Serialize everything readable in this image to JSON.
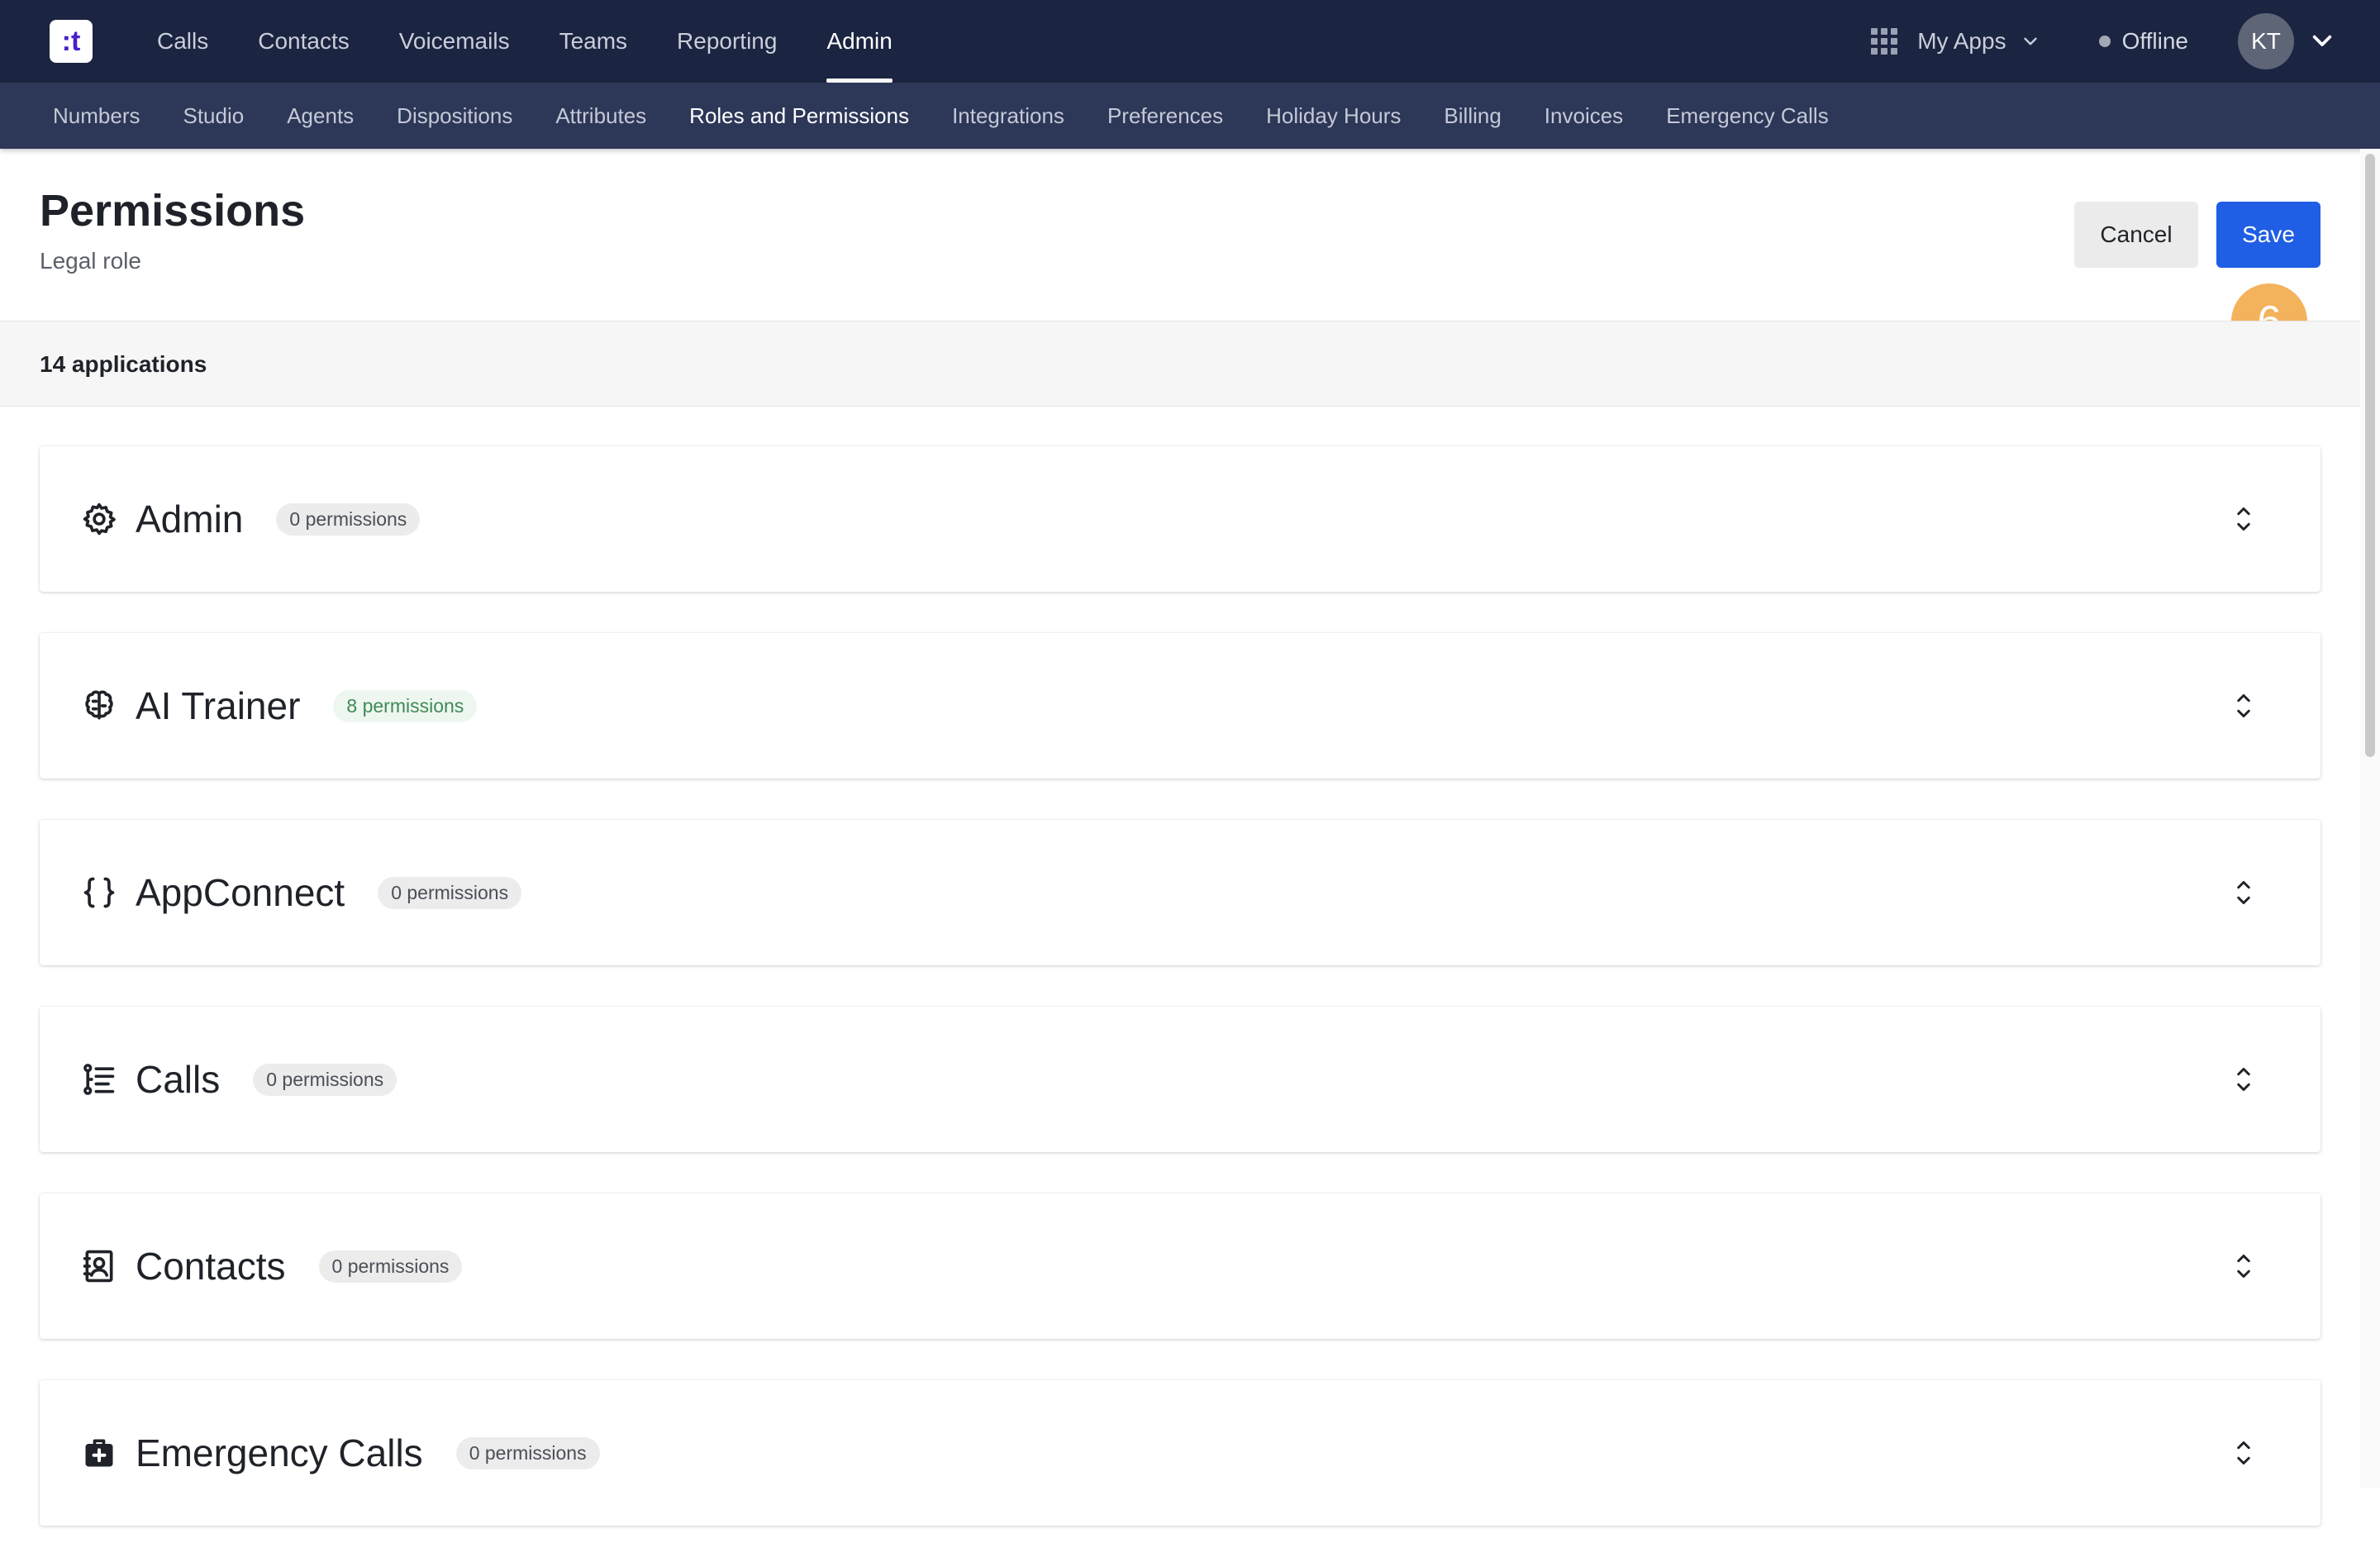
{
  "logo": {
    "text": ":t"
  },
  "topnav": [
    {
      "label": "Calls",
      "name": "topnav-calls"
    },
    {
      "label": "Contacts",
      "name": "topnav-contacts"
    },
    {
      "label": "Voicemails",
      "name": "topnav-voicemails"
    },
    {
      "label": "Teams",
      "name": "topnav-teams"
    },
    {
      "label": "Reporting",
      "name": "topnav-reporting"
    },
    {
      "label": "Admin",
      "name": "topnav-admin",
      "active": true
    }
  ],
  "topright": {
    "apps_label": "My Apps",
    "status_label": "Offline",
    "avatar_initials": "KT"
  },
  "subnav": [
    {
      "label": "Numbers"
    },
    {
      "label": "Studio"
    },
    {
      "label": "Agents"
    },
    {
      "label": "Dispositions"
    },
    {
      "label": "Attributes"
    },
    {
      "label": "Roles and Permissions",
      "active": true
    },
    {
      "label": "Integrations"
    },
    {
      "label": "Preferences"
    },
    {
      "label": "Holiday Hours"
    },
    {
      "label": "Billing"
    },
    {
      "label": "Invoices"
    },
    {
      "label": "Emergency Calls"
    }
  ],
  "header": {
    "title": "Permissions",
    "subtitle": "Legal role",
    "cancel_label": "Cancel",
    "save_label": "Save",
    "step_badge": "6"
  },
  "applications": {
    "count_label": "14 applications",
    "items": [
      {
        "title": "Admin",
        "permissions": "0 permissions",
        "icon": "gear-icon",
        "highlight": false
      },
      {
        "title": "AI Trainer",
        "permissions": "8 permissions",
        "icon": "brain-icon",
        "highlight": true
      },
      {
        "title": "AppConnect",
        "permissions": "0 permissions",
        "icon": "braces-icon",
        "highlight": false
      },
      {
        "title": "Calls",
        "permissions": "0 permissions",
        "icon": "call-list-icon",
        "highlight": false
      },
      {
        "title": "Contacts",
        "permissions": "0 permissions",
        "icon": "contact-book-icon",
        "highlight": false
      },
      {
        "title": "Emergency Calls",
        "permissions": "0 permissions",
        "icon": "medical-kit-icon",
        "highlight": false
      }
    ]
  },
  "colors": {
    "topbar": "#1b2440",
    "subbar": "#2d3758",
    "save_button": "#1f5ee5",
    "step_badge": "#f3b25c",
    "highlight_pill_text": "#3e8a55"
  }
}
